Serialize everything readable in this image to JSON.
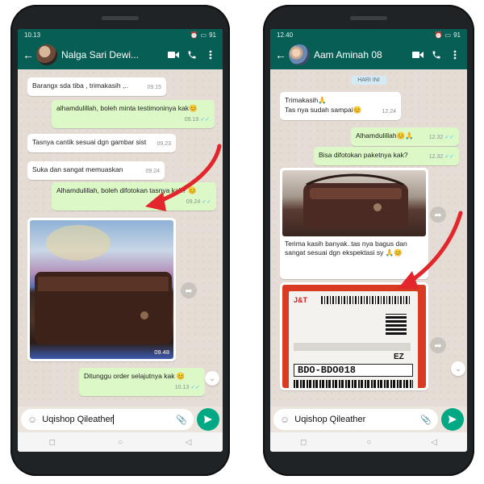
{
  "colors": {
    "header": "#075e54",
    "incoming": "#ffffff",
    "outgoing": "#dcf8c6",
    "send": "#00a884",
    "arrow": "#e3262b"
  },
  "left": {
    "status": {
      "time": "10.13",
      "right": "91"
    },
    "contact": "Nalga Sari Dewi...",
    "icons": [
      "back-arrow-icon",
      "video-call-icon",
      "phone-icon",
      "more-vert-icon"
    ],
    "messages": [
      {
        "dir": "in",
        "text": "Barangx sda tiba , trimakasih ,..",
        "time": "09.15"
      },
      {
        "dir": "out",
        "text": "alhamdulillah, boleh minta testimoninya kak😊",
        "time": "09.19"
      },
      {
        "dir": "in",
        "text": "Tasnya cantik sesuai dgn gambar sist",
        "time": "09.23"
      },
      {
        "dir": "in",
        "text": "Suka dan sangat memuaskan",
        "time": "09.24"
      },
      {
        "dir": "out",
        "text": "Alhamdulillah, boleh difotokan tasnya kak? 😊",
        "time": "09.24"
      },
      {
        "dir": "in",
        "image": "brown-leather-bag-photo",
        "time": "09.48"
      },
      {
        "dir": "out",
        "text": "Ditunggu order selajutnya kak 😊",
        "time": "10.13"
      }
    ],
    "input": "Uqishop Qileather"
  },
  "right": {
    "status": {
      "time": "12.40",
      "right": "91"
    },
    "contact": "Aam Aminah 08",
    "date_chip": "HARI INI",
    "messages": [
      {
        "dir": "in",
        "text": "Trimakasih🙏",
        "time": ""
      },
      {
        "dir": "in",
        "text": "Tas nya sudah sampai😊",
        "time": "12.24"
      },
      {
        "dir": "out",
        "text": "Alhamdulillah😊🙏",
        "time": "12.32"
      },
      {
        "dir": "out",
        "text": "Bisa difotokan paketnya kak?",
        "time": "12.32"
      },
      {
        "dir": "in",
        "image": "leather-bag-photo",
        "caption": "Terima kasih banyak..tas nya bagus dan sangat sesuai dgn ekspektasi sy 🙏😊"
      },
      {
        "dir": "in",
        "image": "shipping-label-photo",
        "label_brand": "J&T",
        "label_code": "BDO-BDO018",
        "label_ez": "EZ"
      }
    ],
    "input": "Uqishop Qileather"
  },
  "nav": {
    "square": "◻",
    "circle": "○",
    "triangle": "◁"
  }
}
